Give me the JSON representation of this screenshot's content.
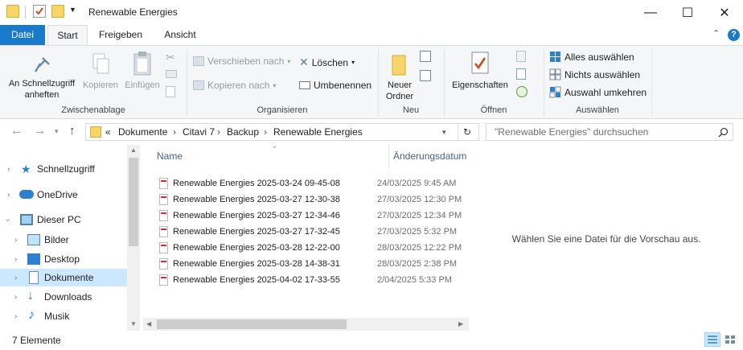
{
  "window": {
    "title": "Renewable Energies",
    "minimize_glyph": "—",
    "maximize_glyph": "☐",
    "close_glyph": "✕"
  },
  "tabs": [
    {
      "label": "Datei"
    },
    {
      "label": "Start"
    },
    {
      "label": "Freigeben"
    },
    {
      "label": "Ansicht"
    }
  ],
  "ribbon": {
    "clipboard": {
      "pin_label": "An Schnellzugriff anheften",
      "copy_label": "Kopieren",
      "paste_label": "Einfügen",
      "group_label": "Zwischenablage"
    },
    "organize": {
      "move_label": "Verschieben nach",
      "copyto_label": "Kopieren nach",
      "delete_label": "Löschen",
      "rename_label": "Umbenennen",
      "group_label": "Organisieren"
    },
    "new": {
      "new_folder_label": "Neuer Ordner",
      "group_label": "Neu"
    },
    "open": {
      "properties_label": "Eigenschaften",
      "group_label": "Öffnen"
    },
    "select": {
      "select_all_label": "Alles auswählen",
      "select_none_label": "Nichts auswählen",
      "invert_label": "Auswahl umkehren",
      "group_label": "Auswählen"
    }
  },
  "address": {
    "overflow": "«",
    "crumbs": [
      "Dokumente",
      "Citavi 7",
      "Backup",
      "Renewable Energies"
    ],
    "search_placeholder": "\"Renewable Energies\" durchsuchen"
  },
  "nav": {
    "items": [
      {
        "label": "Schnellzugriff",
        "icon": "star-icon"
      },
      {
        "label": "OneDrive",
        "icon": "cloud-icon"
      },
      {
        "label": "Dieser PC",
        "icon": "computer-icon"
      },
      {
        "label": "Bilder",
        "icon": "pictures-icon"
      },
      {
        "label": "Desktop",
        "icon": "desktop-icon"
      },
      {
        "label": "Dokumente",
        "icon": "documents-icon"
      },
      {
        "label": "Downloads",
        "icon": "download-icon"
      },
      {
        "label": "Musik",
        "icon": "music-icon"
      }
    ]
  },
  "files": {
    "col_name": "Name",
    "col_date": "Änderungsdatum",
    "rows": [
      {
        "name": "Renewable Energies 2025-03-24 09-45-08",
        "date": "24/03/2025 9:45 AM"
      },
      {
        "name": "Renewable Energies 2025-03-27 12-30-38",
        "date": "27/03/2025 12:30 PM"
      },
      {
        "name": "Renewable Energies 2025-03-27 12-34-46",
        "date": "27/03/2025 12:34 PM"
      },
      {
        "name": "Renewable Energies 2025-03-27 17-32-45",
        "date": "27/03/2025 5:32 PM"
      },
      {
        "name": "Renewable Energies 2025-03-28 12-22-00",
        "date": "28/03/2025 12:22 PM"
      },
      {
        "name": "Renewable Energies 2025-03-28 14-38-31",
        "date": "28/03/2025 2:38 PM"
      },
      {
        "name": "Renewable Energies 2025-04-02 17-33-55",
        "date": "2/04/2025 5:33 PM"
      }
    ]
  },
  "preview": {
    "text": "Wählen Sie eine Datei für die Vorschau aus."
  },
  "status": {
    "count": "7 Elemente"
  },
  "colors": {
    "accent": "#1979ca",
    "selection": "#cce8ff",
    "folder": "#f7d56a"
  }
}
